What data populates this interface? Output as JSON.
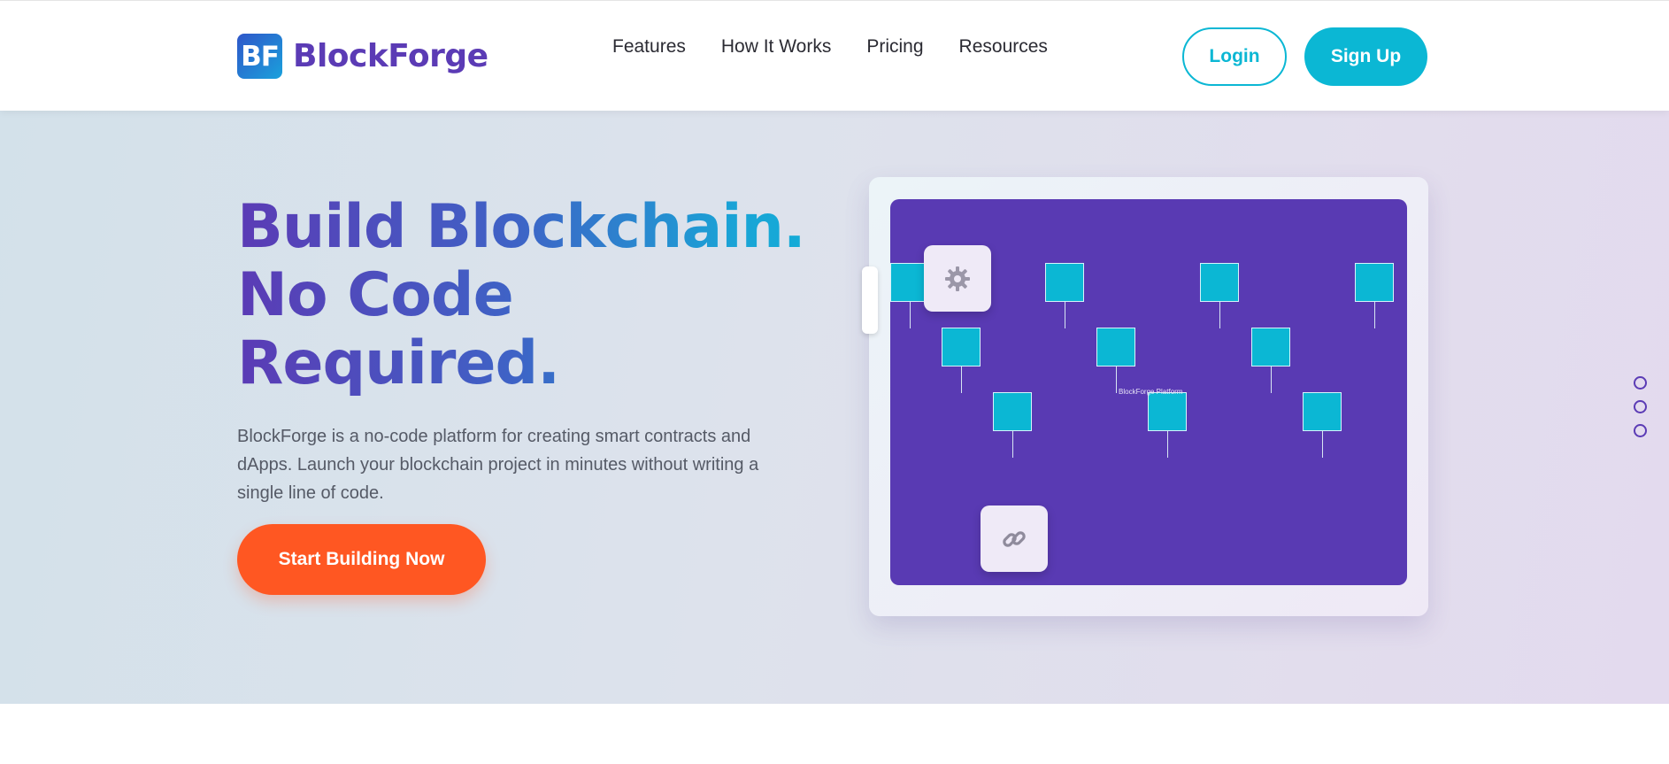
{
  "brand": {
    "logo_mark": "BF",
    "name": "BlockForge",
    "logo_colors": [
      "#2f56c9",
      "#1aa1dc"
    ],
    "name_color": "#5b3bb5"
  },
  "nav": {
    "items": [
      {
        "label": "Features"
      },
      {
        "label": "How It Works"
      },
      {
        "label": "Pricing"
      },
      {
        "label": "Resources"
      }
    ]
  },
  "auth": {
    "login_label": "Login",
    "signup_label": "Sign Up",
    "accent_color": "#0bb7d4"
  },
  "hero": {
    "title_lines": [
      "Build Blockchain.",
      "No Code",
      "Required."
    ],
    "description": "BlockForge is a no-code platform for creating smart contracts and dApps. Launch your blockchain project in minutes without writing a single line of code.",
    "cta_label": "Start Building Now",
    "cta_color": "#ff5722"
  },
  "illustration": {
    "canvas_label": "BlockForge Platform",
    "canvas_color": "#593ab3",
    "node_color": "#0bb7d4",
    "node_count": 11,
    "tiles": [
      {
        "icon": "gear-icon"
      },
      {
        "icon": "chain-link-icon"
      }
    ]
  },
  "pager": {
    "dots": 3
  }
}
